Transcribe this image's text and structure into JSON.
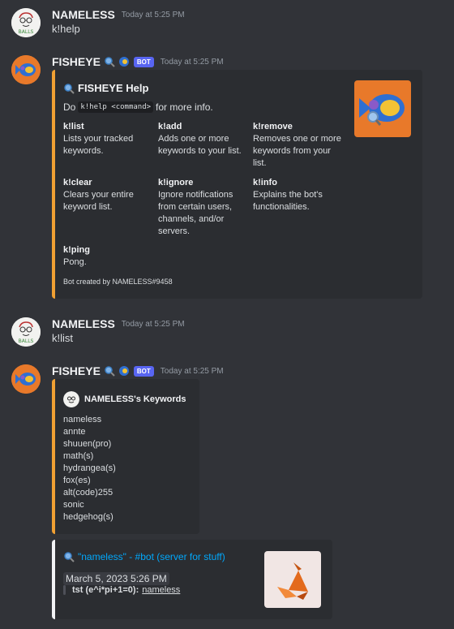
{
  "messages": [
    {
      "username": "NAMELESS",
      "timestamp": "Today at 5:25 PM",
      "text": "k!help"
    },
    {
      "username": "FISHEYE",
      "timestamp": "Today at 5:25 PM",
      "badge": "BOT",
      "embed": {
        "title": "FISHEYE Help",
        "desc_prefix": "Do",
        "desc_code": "k!help <command>",
        "desc_suffix": "for more info.",
        "fields": [
          {
            "name": "k!list",
            "value": "Lists your tracked keywords."
          },
          {
            "name": "k!add",
            "value": "Adds one or more keywords to your list."
          },
          {
            "name": "k!remove",
            "value": "Removes one or more keywords from your list."
          },
          {
            "name": "k!clear",
            "value": "Clears your entire keyword list."
          },
          {
            "name": "k!ignore",
            "value": "Ignore notifications from certain users, channels, and/or servers."
          },
          {
            "name": "k!info",
            "value": "Explains the bot's functionalities."
          },
          {
            "name": "k!ping",
            "value": "Pong."
          }
        ],
        "footer": "Bot created by NAMELESS#9458"
      }
    },
    {
      "username": "NAMELESS",
      "timestamp": "Today at 5:25 PM",
      "text": "k!list"
    },
    {
      "username": "FISHEYE",
      "timestamp": "Today at 5:25 PM",
      "badge": "BOT",
      "embed": {
        "author": "NAMELESS's Keywords",
        "keywords": [
          "nameless",
          "annte",
          "shuuen(pro)",
          "math(s)",
          "hydrangea(s)",
          "fox(es)",
          "alt(code)255",
          "sonic",
          "hedgehog(s)"
        ]
      },
      "embed2": {
        "title": "\"nameless\" - #bot (server for stuff)",
        "date": "March 5, 2023 5:26 PM",
        "quote_author": "tst (e^i*pi+1=0):",
        "quote_text": "nameless"
      }
    }
  ],
  "avatar_text": "BALLS",
  "colors": {
    "bg": "#313338",
    "embed_bg": "#2b2d31",
    "accent": "#f0a033",
    "blurple": "#5865f2",
    "link": "#00a8fc"
  },
  "icons": [
    "magnifier-icon",
    "fish-icon",
    "sketch-avatar",
    "fox-origami-image"
  ]
}
